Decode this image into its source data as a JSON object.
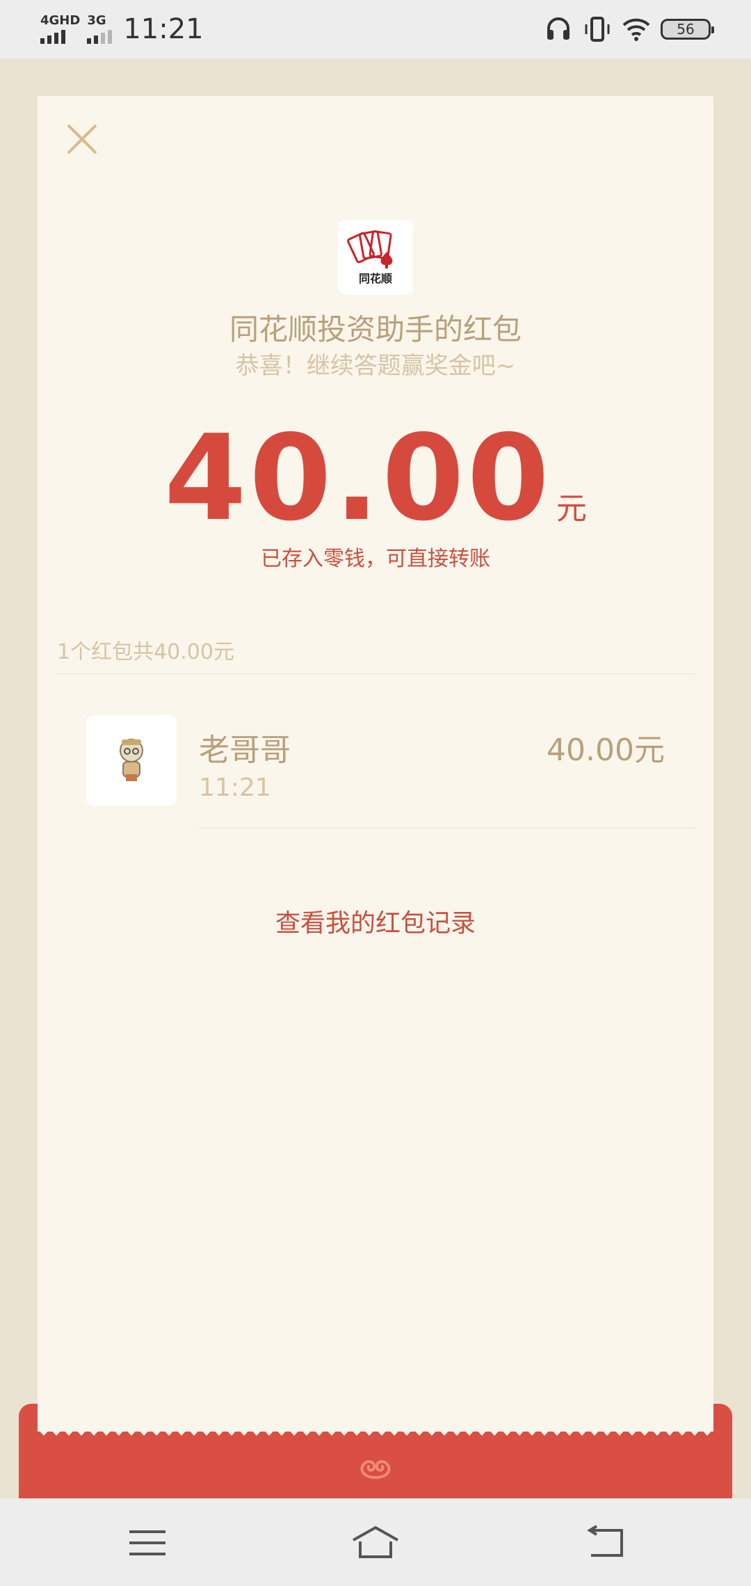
{
  "status_bar": {
    "network_1": "4GHD",
    "network_2": "3G",
    "time": "11:21",
    "battery": "56",
    "icons": [
      "headset-icon",
      "vibrate-icon",
      "wifi-icon",
      "battery-icon"
    ]
  },
  "card": {
    "close_icon": "close-icon",
    "logo_text": "同花顺",
    "sender_title": "同花顺投资助手的红包",
    "greeting": "恭喜！继续答题赢奖金吧~",
    "amount": "40.00",
    "amount_unit": "元",
    "deposit_note": "已存入零钱，可直接转账",
    "summary": "1个红包共40.00元",
    "records": [
      {
        "name": "老哥哥",
        "time": "11:21",
        "amount": "40.00元"
      }
    ],
    "records_link": "查看我的红包记录"
  },
  "colors": {
    "accent_red": "#d64a3e",
    "gold_text": "#b8a07a",
    "light_gold_text": "#d6c4a6",
    "card_bg": "#faf6ec",
    "envelope_red": "#d94f43"
  },
  "nav_bar": {
    "icons": [
      "menu-icon",
      "home-icon",
      "back-icon"
    ]
  }
}
